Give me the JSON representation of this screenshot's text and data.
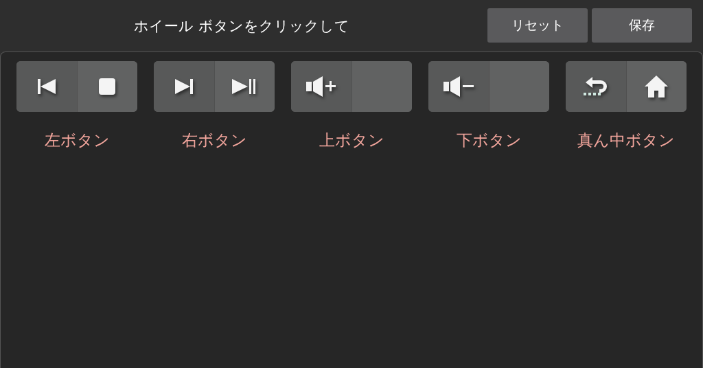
{
  "header": {
    "title": "ホイール ボタンをクリックして",
    "buttons": [
      "リセット",
      "保存"
    ]
  },
  "groups": [
    {
      "label": "左ボタン",
      "slots": [
        {
          "kind": "previous"
        },
        {
          "kind": "stop"
        }
      ]
    },
    {
      "label": "右ボタン",
      "slots": [
        {
          "kind": "next"
        },
        {
          "kind": "play-pause"
        }
      ]
    },
    {
      "label": "上ボタン",
      "slots": [
        {
          "kind": "volume-up"
        },
        {
          "kind": "empty"
        }
      ]
    },
    {
      "label": "下ボタン",
      "slots": [
        {
          "kind": "volume-down"
        },
        {
          "kind": "empty"
        }
      ]
    },
    {
      "label": "真ん中ボタン",
      "slots": [
        {
          "kind": "back"
        },
        {
          "kind": "home"
        }
      ]
    }
  ]
}
